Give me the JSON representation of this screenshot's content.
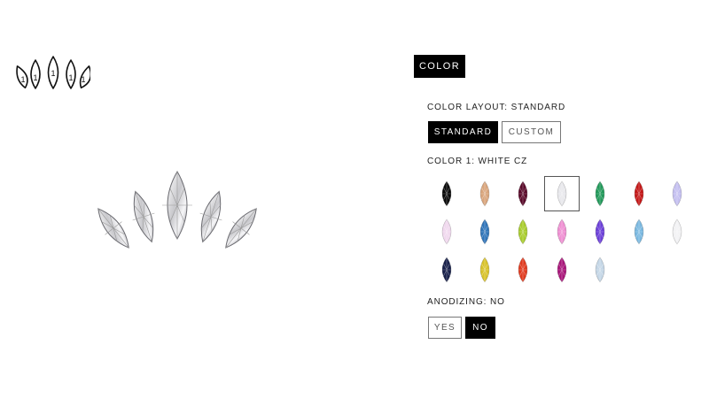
{
  "tab": {
    "label": "COLOR"
  },
  "color_layout": {
    "label": "COLOR LAYOUT: STANDARD",
    "options": [
      {
        "label": "STANDARD",
        "selected": true
      },
      {
        "label": "CUSTOM",
        "selected": false
      }
    ]
  },
  "color1": {
    "label": "COLOR 1: WHITE CZ",
    "selected_index": 3,
    "swatches": [
      {
        "color": "#0a0a0a",
        "icon": "marquise-gem"
      },
      {
        "color": "#d9a57c",
        "icon": "marquise-gem"
      },
      {
        "color": "#5a0a2a",
        "icon": "marquise-gem"
      },
      {
        "color": "#e8e8ec",
        "icon": "marquise-gem"
      },
      {
        "color": "#22995a",
        "icon": "marquise-gem"
      },
      {
        "color": "#c41818",
        "icon": "marquise-gem"
      },
      {
        "color": "#c4bff0",
        "icon": "marquise-gem"
      },
      {
        "color": "#f0d8ee",
        "icon": "marquise-gem"
      },
      {
        "color": "#2f74b8",
        "icon": "marquise-gem"
      },
      {
        "color": "#a8cc2c",
        "icon": "marquise-gem"
      },
      {
        "color": "#ef8fd2",
        "icon": "marquise-gem"
      },
      {
        "color": "#6b3fd8",
        "icon": "marquise-gem"
      },
      {
        "color": "#7ab8e0",
        "icon": "marquise-gem"
      },
      {
        "color": "#f2f2f4",
        "icon": "marquise-gem"
      },
      {
        "color": "#18204a",
        "icon": "marquise-gem"
      },
      {
        "color": "#d8c22a",
        "icon": "marquise-gem"
      },
      {
        "color": "#e03a1e",
        "icon": "marquise-gem"
      },
      {
        "color": "#a8167a",
        "icon": "marquise-gem"
      },
      {
        "color": "#c4d6e6",
        "icon": "marquise-gem"
      }
    ]
  },
  "anodizing": {
    "label": "ANODIZING: NO",
    "options": [
      {
        "label": "YES",
        "selected": false
      },
      {
        "label": "NO",
        "selected": true
      }
    ]
  }
}
